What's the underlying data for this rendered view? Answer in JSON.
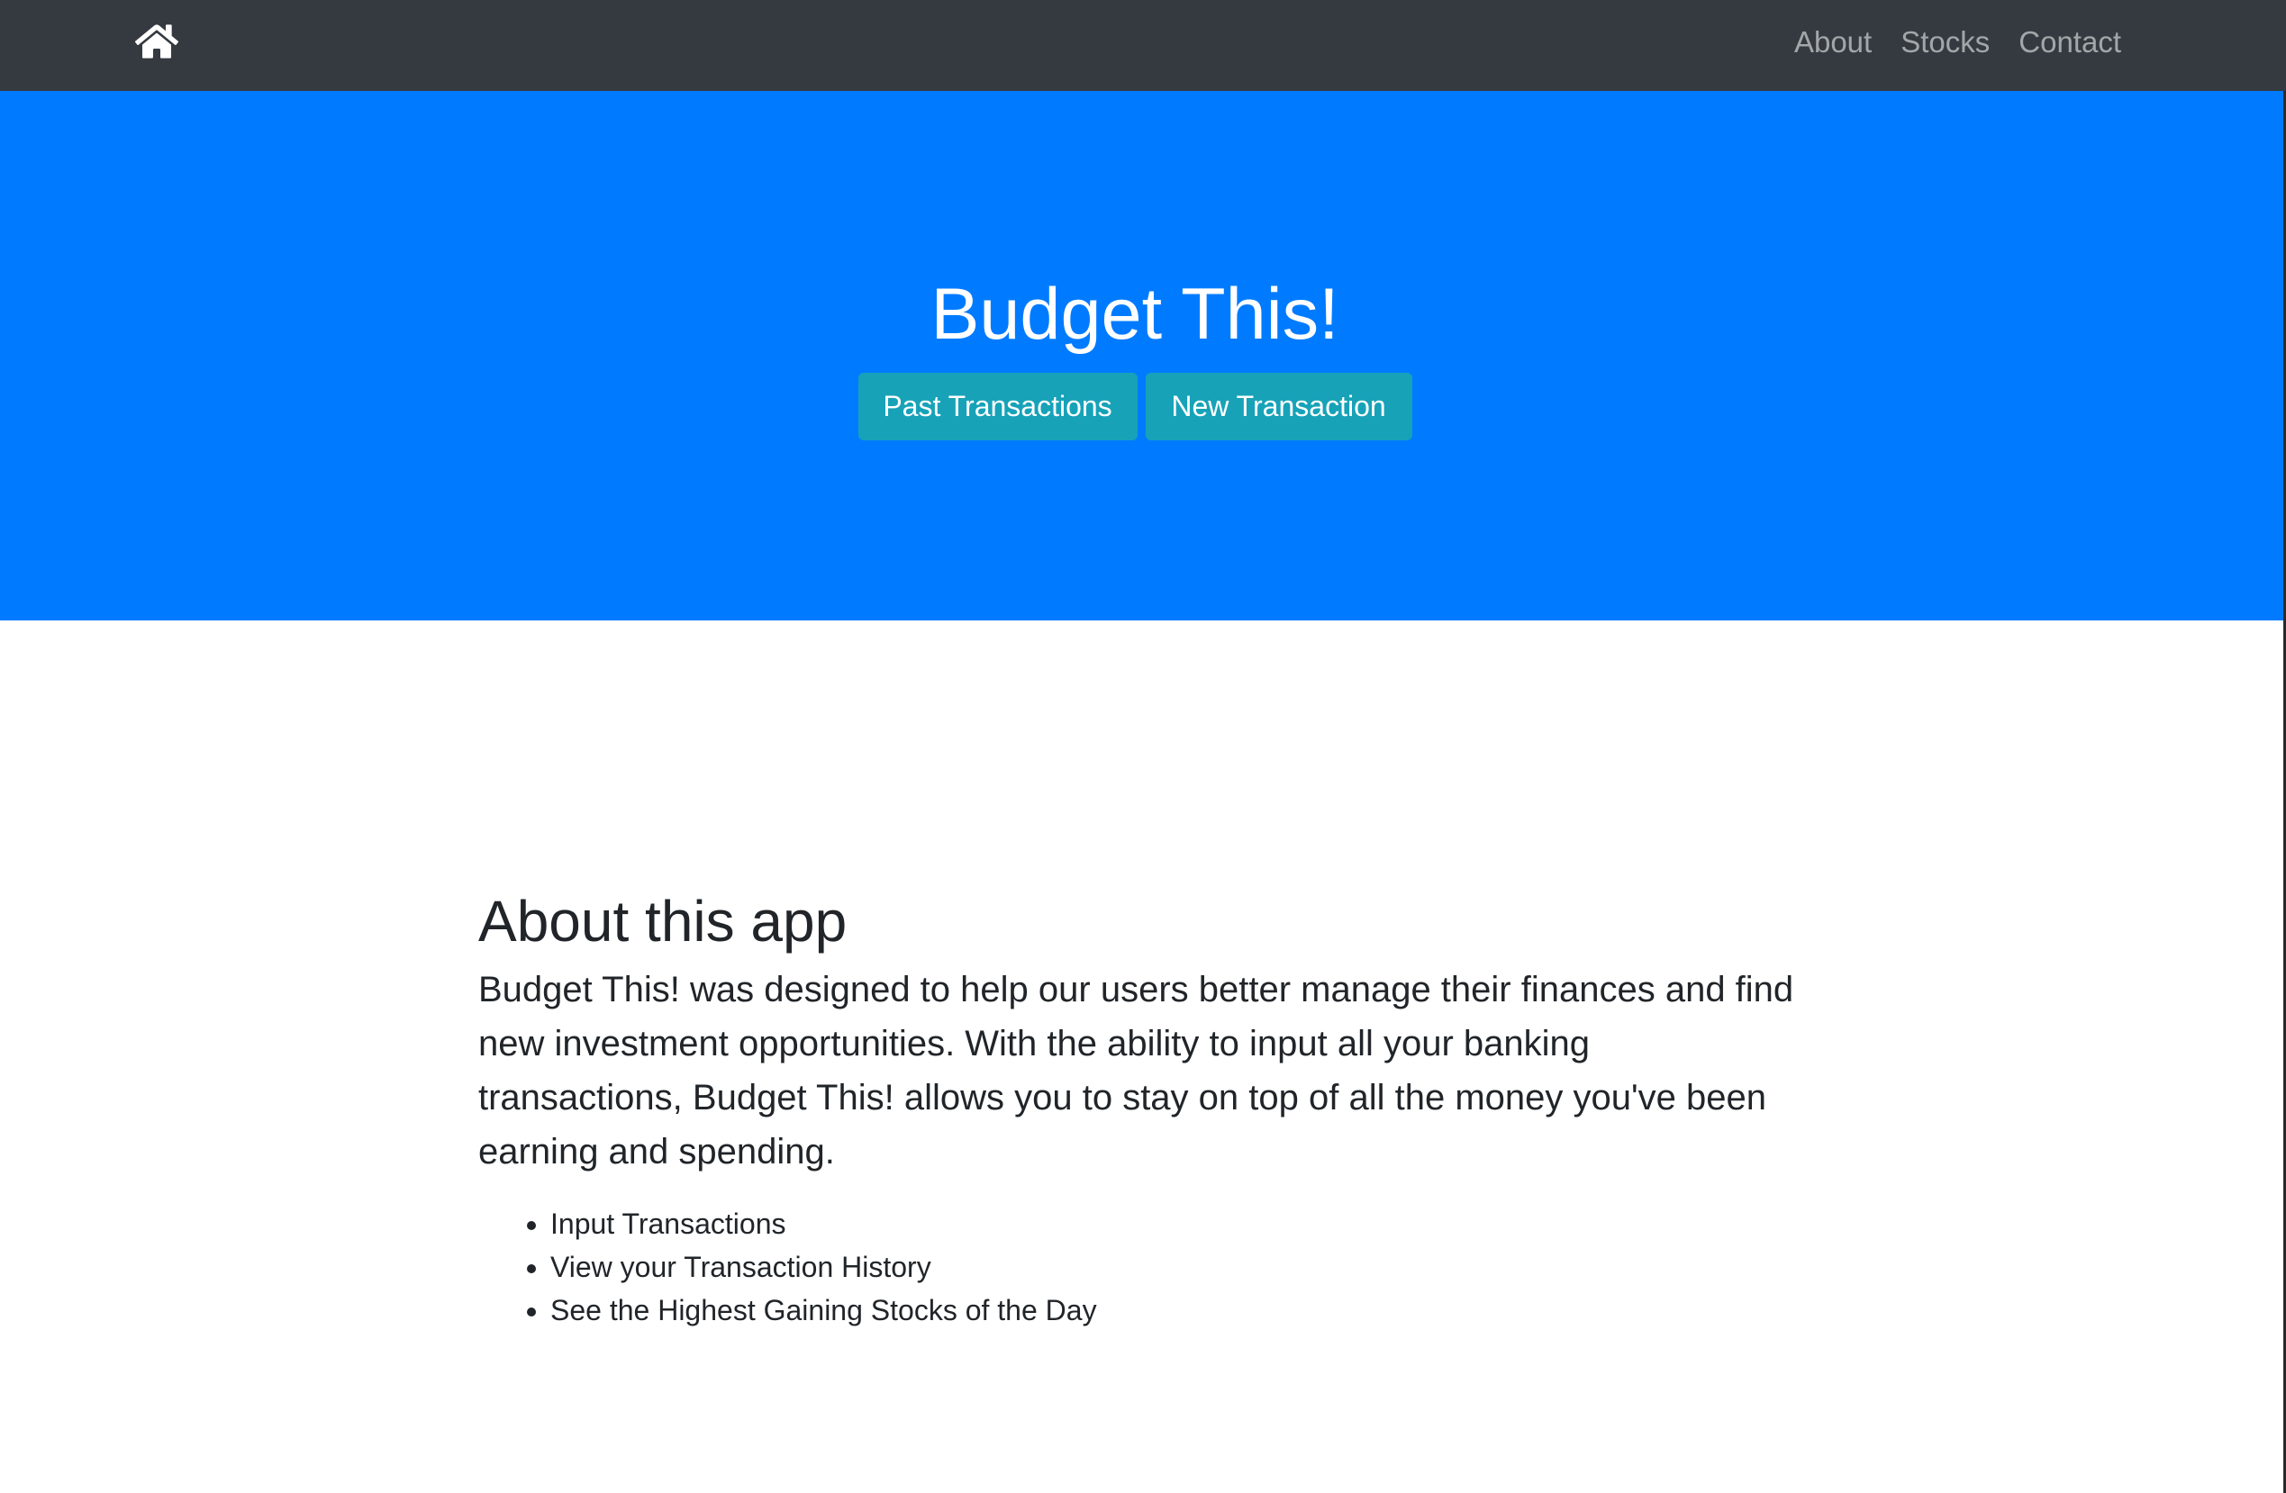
{
  "navbar": {
    "home_icon": "home-icon",
    "links": [
      "About",
      "Stocks",
      "Contact"
    ]
  },
  "hero": {
    "title": "Budget This!",
    "buttons": {
      "past": "Past Transactions",
      "new": "New Transaction"
    }
  },
  "about": {
    "heading": "About this app",
    "text": "Budget This! was designed to help our users better manage their finances and find new investment opportunities. With the ability to input all your banking transactions, Budget This! allows you to stay on top of all the money you've been earning and spending.",
    "features": [
      "Input Transactions",
      "View your Transaction History",
      "See the Highest Gaining Stocks of the Day"
    ]
  },
  "colors": {
    "navbar": "#343a40",
    "hero": "#007bff",
    "button": "#17a2b8",
    "text": "#212529"
  }
}
